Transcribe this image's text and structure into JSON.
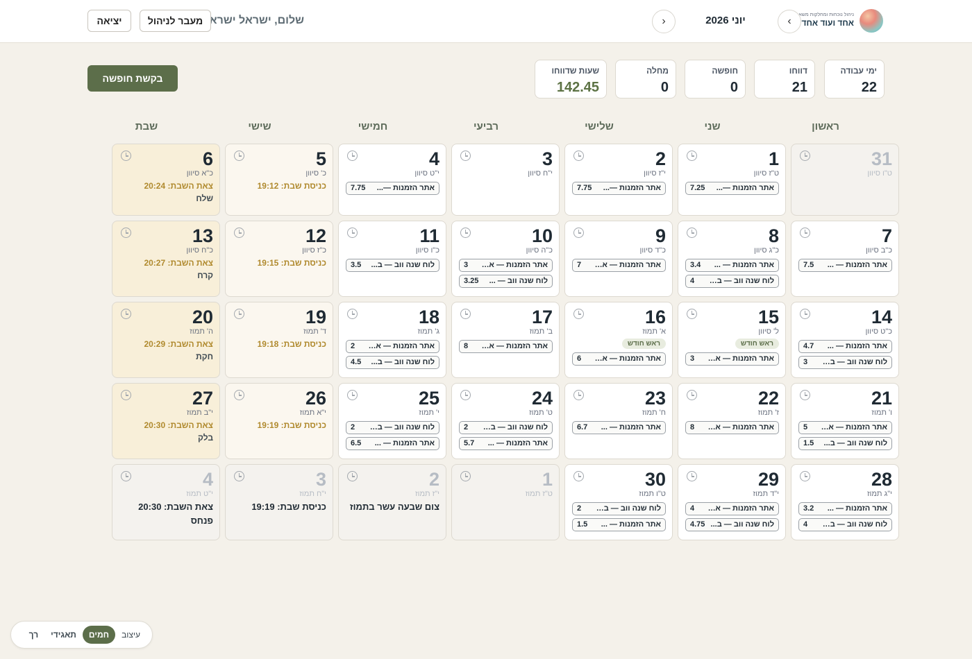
{
  "header": {
    "brand_sub": "ניהול נוכחות ומחלקות משאבים",
    "brand_main": "אחד ועוד אחד",
    "month": "יוני 2026",
    "prev_icon": "‹",
    "next_icon": "›",
    "greeting": "שלום, ישראל ישראלי",
    "admin_button": "מעבר לניהול",
    "logout_button": "יציאה"
  },
  "stats": [
    {
      "label": "ימי עבודה",
      "value": "22"
    },
    {
      "label": "דווחו",
      "value": "21"
    },
    {
      "label": "חופשה",
      "value": "0"
    },
    {
      "label": "מחלה",
      "value": "0"
    },
    {
      "label": "שעות שדווחו",
      "value": "142.45"
    }
  ],
  "vacation_button": "בקשת חופשה",
  "days": [
    "ראשון",
    "שני",
    "שלישי",
    "רביעי",
    "חמישי",
    "שישי",
    "שבת"
  ],
  "weeks": [
    [
      {
        "num": "31",
        "heb": "ט\"ו סיוון",
        "out": true
      },
      {
        "num": "1",
        "heb": "ט\"ז סיוון",
        "entries": [
          {
            "label": "אתר הזמנות —...",
            "hours": "7.25"
          }
        ]
      },
      {
        "num": "2",
        "heb": "י\"ז סיוון",
        "entries": [
          {
            "label": "אתר הזמנות —...",
            "hours": "7.75"
          }
        ]
      },
      {
        "num": "3",
        "heb": "י\"ח סיוון"
      },
      {
        "num": "4",
        "heb": "י\"ט סיוון",
        "entries": [
          {
            "label": "אתר הזמנות —...",
            "hours": "7.75"
          }
        ]
      },
      {
        "num": "5",
        "heb": "כ' סיוון",
        "shab": "כניסת שבת: 19:12"
      },
      {
        "num": "6",
        "heb": "כ\"א סיוון",
        "shab": "צאת השבת: 20:24",
        "parasha": "שלח"
      }
    ],
    [
      {
        "num": "7",
        "heb": "כ\"ב סיוון",
        "entries": [
          {
            "label": "אתר הזמנות — ...",
            "hours": "7.5"
          }
        ]
      },
      {
        "num": "8",
        "heb": "כ\"ג סיוון",
        "entries": [
          {
            "label": "אתר הזמנות — ...",
            "hours": "3.4"
          },
          {
            "label": "לוח שנה ווב — בטא:",
            "hours": "4"
          }
        ]
      },
      {
        "num": "9",
        "heb": "כ\"ד סיוון",
        "entries": [
          {
            "label": "אתר הזמנות — אל...",
            "hours": "7"
          }
        ]
      },
      {
        "num": "10",
        "heb": "כ\"ה סיוון",
        "entries": [
          {
            "label": "אתר הזמנות — אל...",
            "hours": "3"
          },
          {
            "label": "לוח שנה ווב — ...",
            "hours": "3.25"
          }
        ]
      },
      {
        "num": "11",
        "heb": "כ\"ו סיוון",
        "entries": [
          {
            "label": "לוח שנה ווב — ב...",
            "hours": "3.5"
          }
        ]
      },
      {
        "num": "12",
        "heb": "כ\"ז סיוון",
        "shab": "כניסת שבת: 19:15"
      },
      {
        "num": "13",
        "heb": "כ\"ח סיוון",
        "shab": "צאת השבת: 20:27",
        "parasha": "קרח"
      }
    ],
    [
      {
        "num": "14",
        "heb": "כ\"ט סיוון",
        "entries": [
          {
            "label": "אתר הזמנות — ...",
            "hours": "4.7"
          },
          {
            "label": "לוח שנה ווב — בטא:",
            "hours": "3"
          }
        ]
      },
      {
        "num": "15",
        "heb": "ל' סיוון",
        "rosh": "ראש חודש",
        "entries": [
          {
            "label": "אתר הזמנות — אל...",
            "hours": "3"
          }
        ]
      },
      {
        "num": "16",
        "heb": "א' תמוז",
        "rosh": "ראש חודש",
        "entries": [
          {
            "label": "אתר הזמנות — אל...",
            "hours": "6"
          }
        ]
      },
      {
        "num": "17",
        "heb": "ב' תמוז",
        "entries": [
          {
            "label": "אתר הזמנות — אל...",
            "hours": "8"
          }
        ]
      },
      {
        "num": "18",
        "heb": "ג' תמוז",
        "entries": [
          {
            "label": "אתר הזמנות — אל...",
            "hours": "2"
          },
          {
            "label": "לוח שנה ווב — ב...",
            "hours": "4.5"
          }
        ]
      },
      {
        "num": "19",
        "heb": "ד' תמוז",
        "shab": "כניסת שבת: 19:18"
      },
      {
        "num": "20",
        "heb": "ה' תמוז",
        "shab": "צאת השבת: 20:29",
        "parasha": "חקת"
      }
    ],
    [
      {
        "num": "21",
        "heb": "ו' תמוז",
        "entries": [
          {
            "label": "אתר הזמנות — אל...",
            "hours": "5"
          },
          {
            "label": "לוח שנה ווב — ב...",
            "hours": "1.5"
          }
        ]
      },
      {
        "num": "22",
        "heb": "ז' תמוז",
        "entries": [
          {
            "label": "אתר הזמנות — אל...",
            "hours": "8"
          }
        ]
      },
      {
        "num": "23",
        "heb": "ח' תמוז",
        "entries": [
          {
            "label": "אתר הזמנות — ...",
            "hours": "6.7"
          }
        ]
      },
      {
        "num": "24",
        "heb": "ט' תמוז",
        "entries": [
          {
            "label": "לוח שנה ווב — בטא:",
            "hours": "2"
          },
          {
            "label": "אתר הזמנות — ...",
            "hours": "5.7"
          }
        ]
      },
      {
        "num": "25",
        "heb": "י' תמוז",
        "entries": [
          {
            "label": "לוח שנה ווב — בטא:",
            "hours": "2"
          },
          {
            "label": "אתר הזמנות — ...",
            "hours": "6.5"
          }
        ]
      },
      {
        "num": "26",
        "heb": "י\"א תמוז",
        "shab": "כניסת שבת: 19:19"
      },
      {
        "num": "27",
        "heb": "י\"ב תמוז",
        "shab": "צאת השבת: 20:30",
        "parasha": "בלק"
      }
    ],
    [
      {
        "num": "28",
        "heb": "י\"ג תמוז",
        "entries": [
          {
            "label": "אתר הזמנות — ...",
            "hours": "3.2"
          },
          {
            "label": "לוח שנה ווב — בטא:",
            "hours": "4"
          }
        ]
      },
      {
        "num": "29",
        "heb": "י\"ד תמוז",
        "entries": [
          {
            "label": "אתר הזמנות — אל...",
            "hours": "4"
          },
          {
            "label": "לוח שנה ווב — ב...",
            "hours": "4.75"
          }
        ]
      },
      {
        "num": "30",
        "heb": "ט\"ו תמוז",
        "entries": [
          {
            "label": "לוח שנה ווב — בטא:",
            "hours": "2"
          },
          {
            "label": "אתר הזמנות — ...",
            "hours": "1.5"
          }
        ]
      },
      {
        "num": "1",
        "heb": "ט\"ז תמוז",
        "out": true
      },
      {
        "num": "2",
        "heb": "י\"ז תמוז",
        "out": true,
        "big": "צום שבעה עשר בתמוז"
      },
      {
        "num": "3",
        "heb": "י\"ח תמוז",
        "out": true,
        "big": "כניסת שבת: 19:19"
      },
      {
        "num": "4",
        "heb": "י\"ט תמוז",
        "out": true,
        "big": "צאת השבת: 20:30",
        "big2": "פנחס"
      }
    ]
  ],
  "theme": {
    "options": [
      "עיצוב",
      "חמים",
      "תאגידי",
      "רך"
    ],
    "active": "חמים"
  }
}
